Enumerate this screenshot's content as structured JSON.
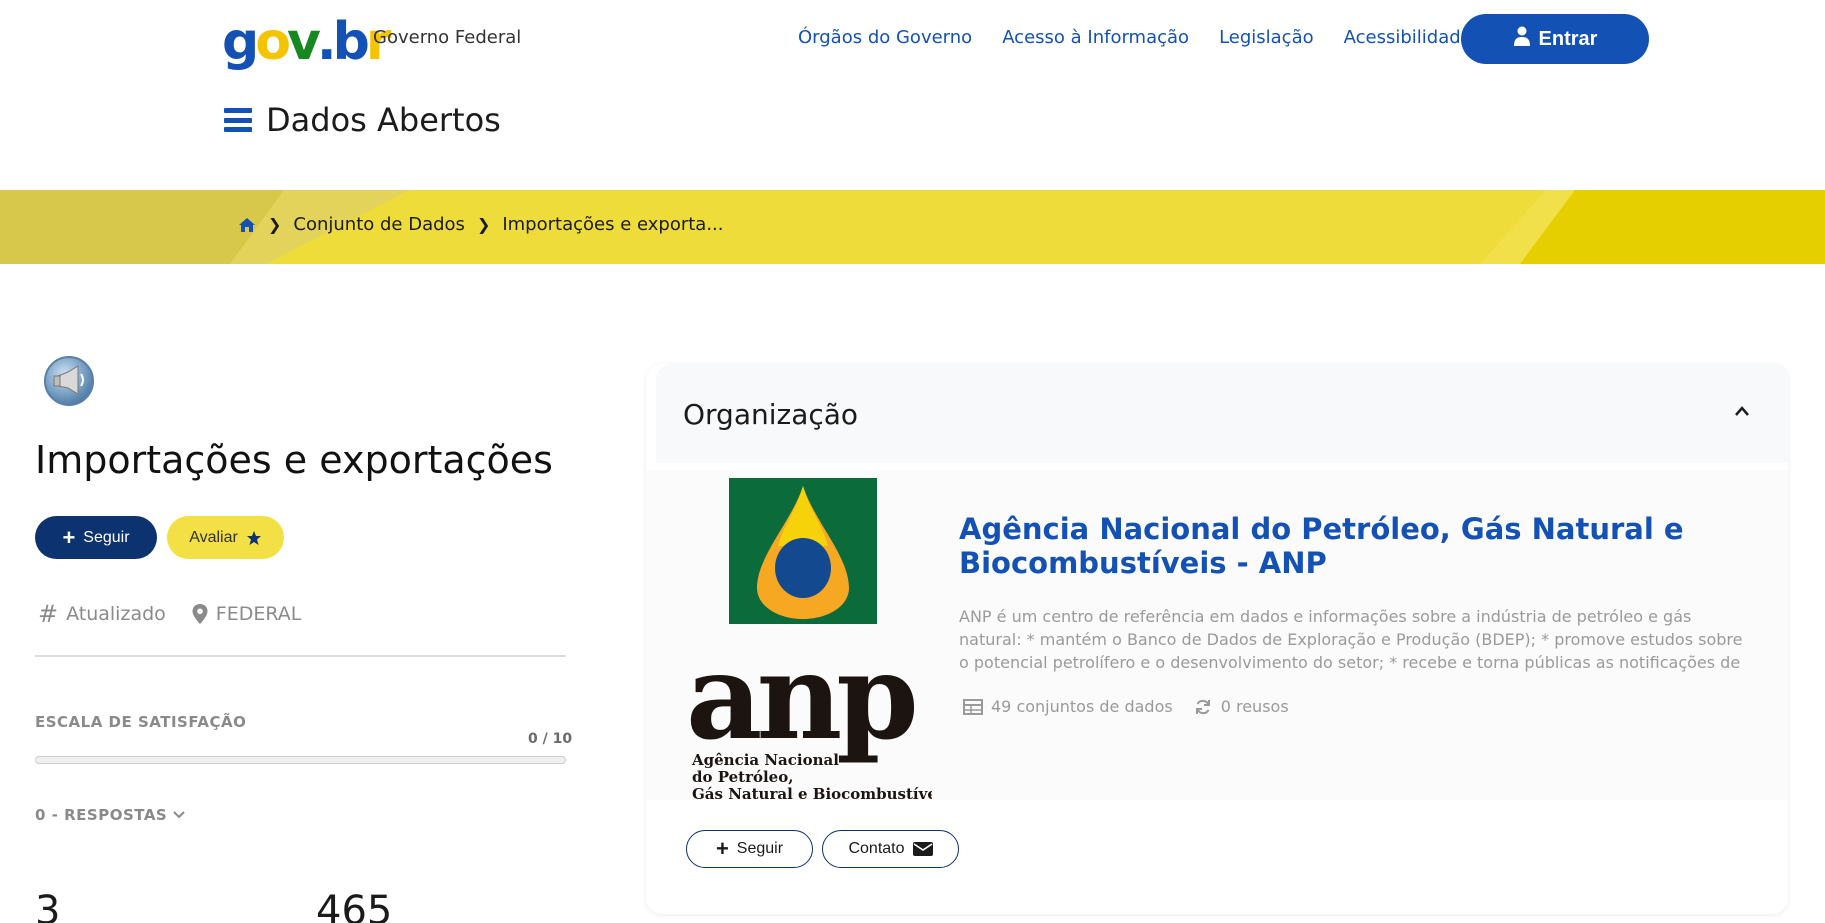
{
  "header": {
    "logo_text": "gov.br",
    "logo_label": "Governo Federal",
    "links": [
      "Órgãos do Governo",
      "Acesso à Informação",
      "Legislação",
      "Acessibilidade"
    ],
    "login_label": "Entrar",
    "site_title": "Dados Abertos"
  },
  "breadcrumb": {
    "items": [
      "Conjunto de Dados",
      "Importações e exporta..."
    ]
  },
  "dataset": {
    "title": "Importações e exportações",
    "follow_label": "Seguir",
    "rate_label": "Avaliar",
    "status": "Atualizado",
    "scope": "FEDERAL",
    "satisfaction_label": "ESCALA DE SATISFAÇÃO",
    "satisfaction_score": "0 / 10",
    "satisfaction_fraction": 0,
    "responses_label": "0 - RESPOSTAS",
    "stats": [
      "3",
      "465"
    ]
  },
  "organization": {
    "section_label": "Organização",
    "name": "Agência Nacional do Petróleo, Gás Natural e Biocombustíveis - ANP",
    "description": "ANP é um centro de referência em dados e informações sobre a indústria de petróleo e gás natural: * mantém o Banco de Dados de Exploração e Produção (BDEP); * promove estudos sobre o potencial petrolífero e o desenvolvimento do setor; * recebe e torna públicas as notificações de descobertas; *...",
    "datasets_count": "49 conjuntos de dados",
    "reuses_count": "0 reusos",
    "follow_label": "Seguir",
    "contact_label": "Contato",
    "logo_word": "anp",
    "logo_caption": [
      "Agência Nacional",
      "do Petróleo,",
      "Gás Natural e Biocombustíveis"
    ]
  },
  "colors": {
    "primary": "#1351b4",
    "dark_blue": "#0c326f",
    "yellow": "#eedc3a"
  },
  "icons": [
    "home-icon",
    "user-icon",
    "menu-icon",
    "star-icon",
    "hash-icon",
    "map-pin-icon",
    "chevron-up-icon",
    "chevron-down-icon",
    "table-icon",
    "refresh-icon",
    "envelope-icon",
    "plus-icon"
  ]
}
